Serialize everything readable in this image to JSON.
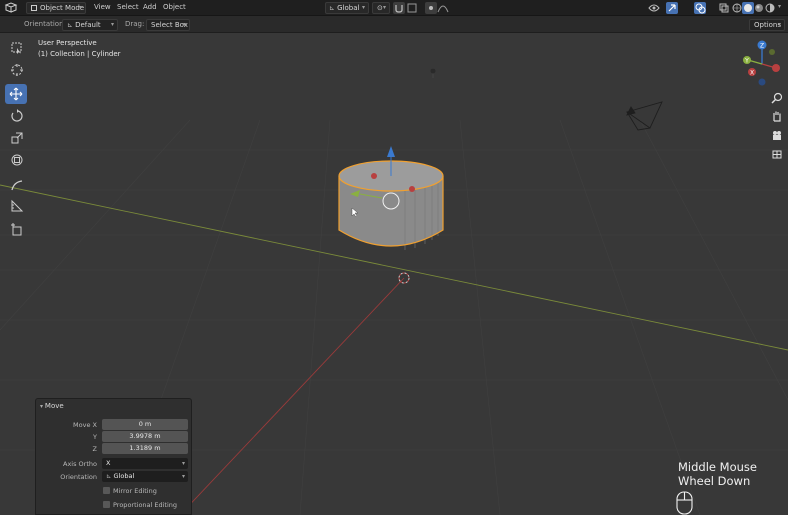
{
  "header": {
    "mode_label": "Object Mode",
    "menus": [
      "View",
      "Select",
      "Add",
      "Object"
    ],
    "transform_space": "Global",
    "options_label": "Options"
  },
  "tool_options": {
    "orientation_label": "Orientation:",
    "orientation_value": "Default",
    "drag_label": "Drag:",
    "drag_value": "Select Box"
  },
  "viewport": {
    "perspective_label": "User Perspective",
    "collection_label": "(1) Collection | Cylinder"
  },
  "gizmo": {
    "x": "X",
    "y": "Y",
    "z": "Z"
  },
  "operator_panel": {
    "title": "Move",
    "move_x_label": "Move X",
    "move_x_value": "0 m",
    "y_label": "Y",
    "y_value": "3.9978 m",
    "z_label": "Z",
    "z_value": "1.3189 m",
    "axis_ortho_label": "Axis Ortho",
    "axis_ortho_value": "X",
    "orientation_label": "Orientation",
    "orientation_value": "Global",
    "mirror_label": "Mirror Editing",
    "proportional_label": "Proportional Editing"
  },
  "mouse_hint": {
    "line1": "Middle Mouse",
    "line2": "Wheel Down"
  },
  "colors": {
    "accent": "#4772b3",
    "selection_outline": "#f0a030",
    "axis_x": "#b84040",
    "axis_y": "#8a9a3a",
    "axis_z": "#3a7ad0"
  }
}
